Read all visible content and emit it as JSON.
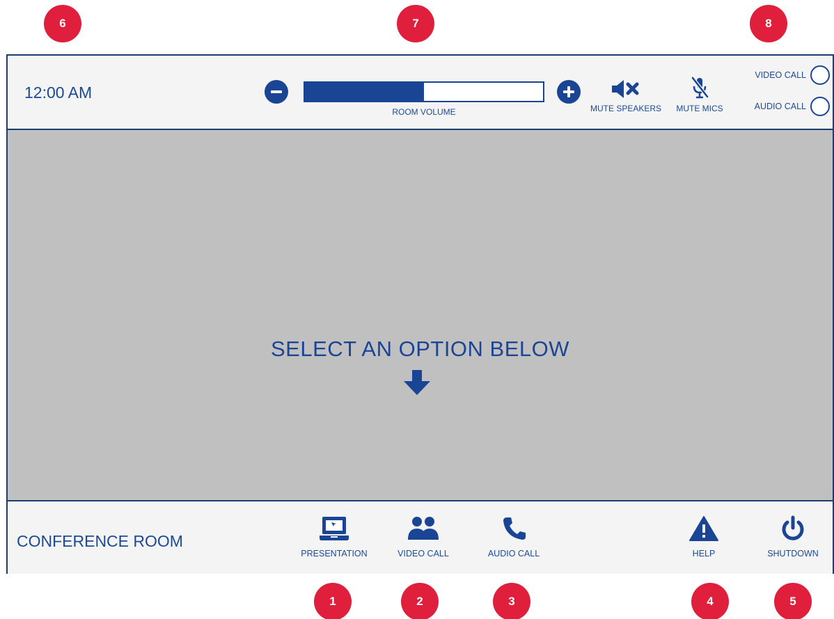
{
  "callouts": [
    "6",
    "7",
    "8",
    "1",
    "2",
    "3",
    "4",
    "5"
  ],
  "header": {
    "clock": "12:00 AM",
    "volume": {
      "label": "ROOM VOLUME",
      "level_percent": 50
    },
    "mute_speakers_label": "MUTE SPEAKERS",
    "mute_mics_label": "MUTE MICS",
    "status": [
      {
        "label": "VIDEO CALL"
      },
      {
        "label": "AUDIO CALL"
      }
    ]
  },
  "main": {
    "prompt": "SELECT AN OPTION BELOW"
  },
  "footer": {
    "room_name": "CONFERENCE ROOM",
    "buttons": [
      {
        "label": "PRESENTATION",
        "icon": "laptop-icon"
      },
      {
        "label": "VIDEO CALL",
        "icon": "people-icon"
      },
      {
        "label": "AUDIO CALL",
        "icon": "phone-icon"
      },
      {
        "label": "HELP",
        "icon": "warning-icon"
      },
      {
        "label": "SHUTDOWN",
        "icon": "power-icon"
      }
    ]
  },
  "colors": {
    "accent": "#1a4594",
    "badge": "#df1f3c",
    "content_bg": "#c0c0c0",
    "bar_bg": "#f4f4f4"
  }
}
